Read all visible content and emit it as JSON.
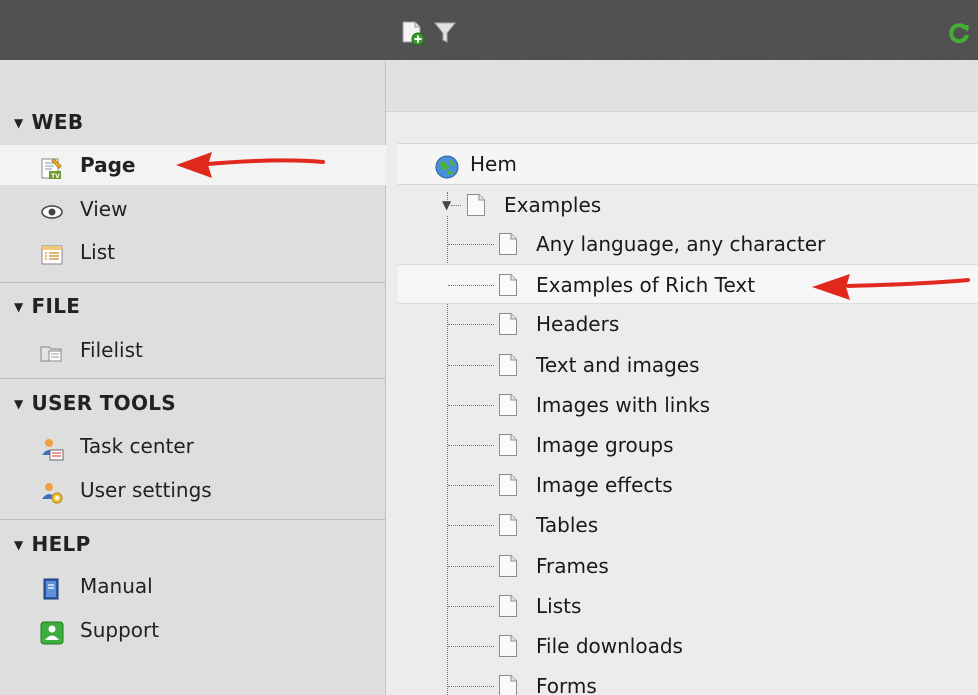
{
  "sidebar": {
    "groups": [
      {
        "label": "WEB",
        "items": [
          {
            "label": "Page",
            "icon": "page-module-icon",
            "active": true
          },
          {
            "label": "View",
            "icon": "eye-icon"
          },
          {
            "label": "List",
            "icon": "list-icon"
          }
        ]
      },
      {
        "label": "FILE",
        "items": [
          {
            "label": "Filelist",
            "icon": "filelist-icon"
          }
        ]
      },
      {
        "label": "USER TOOLS",
        "items": [
          {
            "label": "Task center",
            "icon": "task-center-icon"
          },
          {
            "label": "User settings",
            "icon": "user-settings-icon"
          }
        ]
      },
      {
        "label": "HELP",
        "items": [
          {
            "label": "Manual",
            "icon": "manual-icon"
          },
          {
            "label": "Support",
            "icon": "support-icon"
          }
        ]
      }
    ]
  },
  "toolbar": {
    "icons": [
      "new-page-icon",
      "filter-icon",
      "refresh-icon"
    ]
  },
  "tree": {
    "root": {
      "label": "Hem",
      "icon": "globe-icon"
    },
    "parent": {
      "label": "Examples",
      "icon": "page-icon",
      "expanded": true
    },
    "children": [
      {
        "label": "Any language, any character"
      },
      {
        "label": "Examples of Rich Text",
        "highlighted": true
      },
      {
        "label": "Headers"
      },
      {
        "label": "Text and images"
      },
      {
        "label": "Images with links"
      },
      {
        "label": "Image groups"
      },
      {
        "label": "Image effects"
      },
      {
        "label": "Tables"
      },
      {
        "label": "Frames"
      },
      {
        "label": "Lists"
      },
      {
        "label": "File downloads"
      },
      {
        "label": "Forms"
      }
    ]
  },
  "colors": {
    "topbar": "#505050",
    "sidebar": "#dedede",
    "annotation_arrow": "#e0281c"
  }
}
